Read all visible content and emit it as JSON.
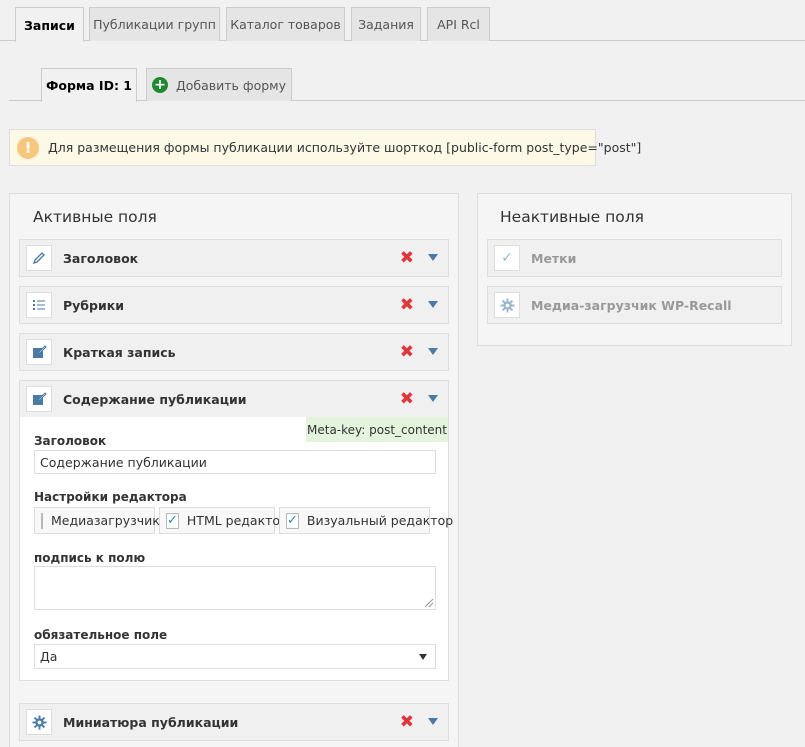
{
  "top_tabs": [
    {
      "label": "Записи",
      "active": true
    },
    {
      "label": "Публикации групп",
      "active": false
    },
    {
      "label": "Каталог товаров",
      "active": false
    },
    {
      "label": "Задания",
      "active": false
    },
    {
      "label": "API Rcl",
      "active": false
    }
  ],
  "sub_tabs": {
    "form": "Форма ID: 1",
    "add": "Добавить форму"
  },
  "notice": {
    "text": "Для размещения формы публикации используйте шорткод [public-form post_type=\"post\"]",
    "icon": "!"
  },
  "active_panel": {
    "title": "Активные поля",
    "fields": [
      {
        "label": "Заголовок",
        "icon": "pencil-icon"
      },
      {
        "label": "Рубрики",
        "icon": "list-icon"
      },
      {
        "label": "Краткая запись",
        "icon": "edit-icon"
      },
      {
        "label": "Содержание публикации",
        "icon": "edit-icon"
      },
      {
        "label": "Миниатюра публикации",
        "icon": "gear-icon"
      }
    ],
    "expanded": {
      "meta_key": "Meta-key: post_content",
      "title_label": "Заголовок",
      "title_value": "Содержание публикации",
      "editor_label": "Настройки редактора",
      "editor_options": [
        {
          "label": "Медиазагрузчик",
          "checked": false
        },
        {
          "label": "HTML редактор",
          "checked": true
        },
        {
          "label": "Визуальный редактор",
          "checked": true
        }
      ],
      "caption_label": "подпись к полю",
      "required_label": "обязательное поле",
      "required_value": "Да"
    }
  },
  "inactive_panel": {
    "title": "Неактивные поля",
    "fields": [
      {
        "label": "Метки",
        "icon": "check-icon"
      },
      {
        "label": "Медиа-загрузчик WP-Recall",
        "icon": "gear-icon"
      }
    ]
  },
  "icons": {
    "delete": "✖",
    "check": "✓"
  },
  "colors": {
    "delete": "#e2363d",
    "accent": "#4a7aa8",
    "plus": "#1d8a32",
    "notice_icon": "#f7c87b",
    "meta_bg": "#e4f4dc"
  }
}
